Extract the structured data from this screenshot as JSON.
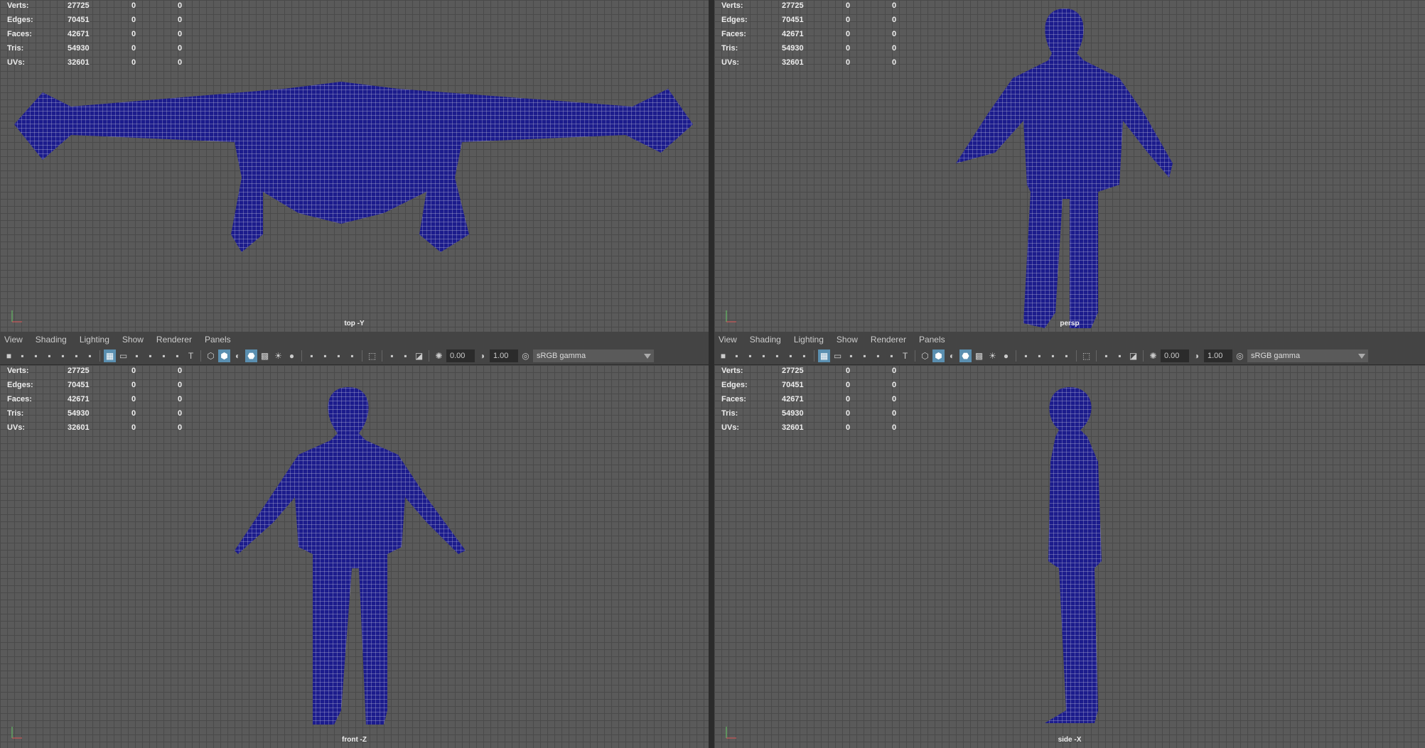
{
  "menu": [
    "View",
    "Shading",
    "Lighting",
    "Show",
    "Renderer",
    "Panels"
  ],
  "toolbar": {
    "icons": [
      "camera-icon",
      "camera-lock-icon",
      "camera-attr-icon",
      "bookmark-icon",
      "image-plane-icon",
      "2d-pan-icon",
      "grease-pencil-icon",
      "|",
      "grid-icon",
      "film-gate-icon",
      "resolution-gate-icon",
      "gate-mask-icon",
      "field-chart-icon",
      "safe-action-icon",
      "safe-title-icon",
      "|",
      "wireframe-icon",
      "smooth-shade-icon",
      "default-material-icon",
      "wireframe-on-shaded-icon",
      "xray-icon",
      "lights-icon",
      "shadows-icon",
      "|",
      "screen-space-ao-icon",
      "motion-blur-icon",
      "anti-alias-icon",
      "depth-of-field-icon",
      "|",
      "isolate-select-icon",
      "|",
      "xray-joints-icon",
      "xray-active-icon",
      "backface-icon",
      "|",
      "exposure-icon",
      "#exposure",
      "gamma-icon",
      "#gamma",
      "color-management-icon",
      "#colorspace"
    ],
    "active": [
      8,
      17,
      19
    ],
    "exposure": "0.00",
    "gamma": "1.00",
    "colorspace": "sRGB gamma"
  },
  "stats": {
    "rows": [
      {
        "label": "Verts:",
        "value": "27725",
        "a": "0",
        "b": "0"
      },
      {
        "label": "Edges:",
        "value": "70451",
        "a": "0",
        "b": "0"
      },
      {
        "label": "Faces:",
        "value": "42671",
        "a": "0",
        "b": "0"
      },
      {
        "label": "Tris:",
        "value": "54930",
        "a": "0",
        "b": "0"
      },
      {
        "label": "UVs:",
        "value": "32601",
        "a": "0",
        "b": "0"
      }
    ]
  },
  "panels": [
    {
      "camera": "top -Y",
      "view": "top",
      "menu": false
    },
    {
      "camera": "persp",
      "view": "persp",
      "menu": false
    },
    {
      "camera": "front -Z",
      "view": "front",
      "menu": true
    },
    {
      "camera": "side -X",
      "view": "side",
      "menu": true
    }
  ],
  "colors": {
    "mesh": "#1c1c8c",
    "wire": "#c8c8e0"
  }
}
